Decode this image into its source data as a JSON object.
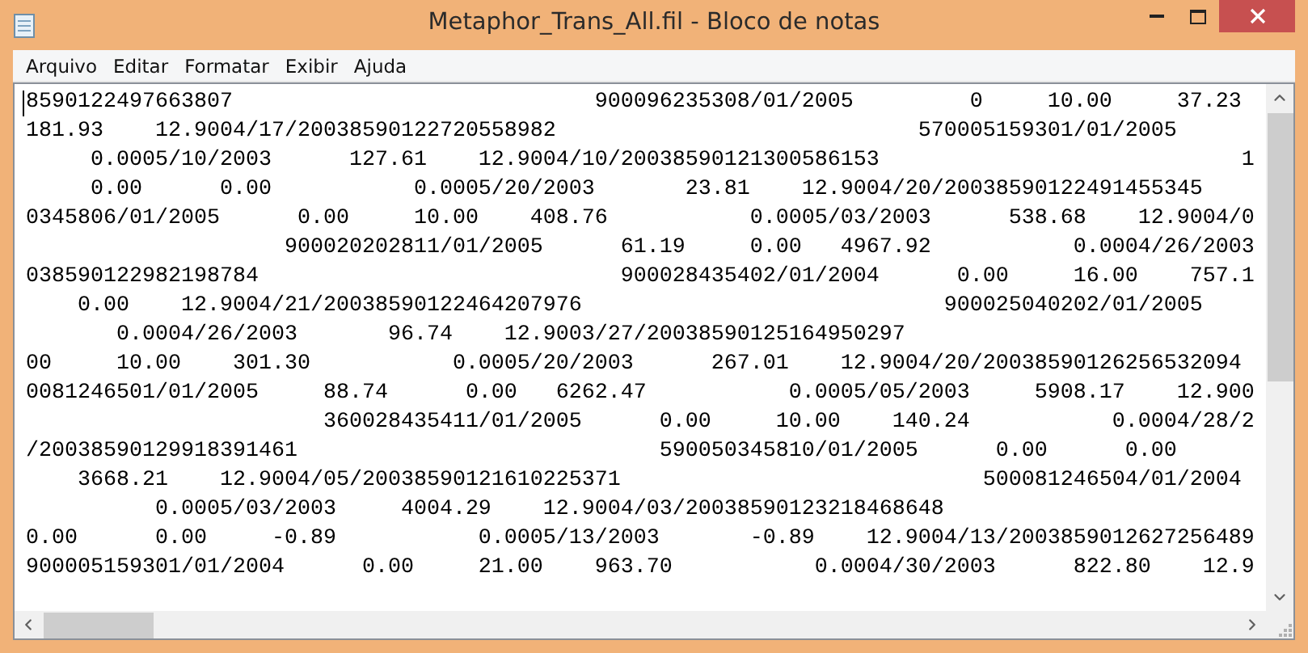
{
  "window": {
    "title": "Metaphor_Trans_All.fil - Bloco de notas"
  },
  "menu": [
    "Arquivo",
    "Editar",
    "Formatar",
    "Exibir",
    "Ajuda"
  ],
  "lines": [
    "8590122497663807                            900096235308/01/2005         0     10.00     37.23",
    "181.93    12.9004/17/20038590122720558982                            570005159301/01/2005",
    "     0.0005/10/2003      127.61    12.9004/10/20038590121300586153                            1",
    "     0.00      0.00           0.0005/20/2003       23.81    12.9004/20/20038590122491455345",
    "0345806/01/2005      0.00     10.00    408.76           0.0005/03/2003      538.68    12.9004/0",
    "                    900020202811/01/2005      61.19     0.00   4967.92           0.0004/26/2003",
    "038590122982198784                            900028435402/01/2004      0.00     16.00    757.1",
    "    0.00    12.9004/21/20038590122464207976                            900025040202/01/2005",
    "       0.0004/26/2003       96.74    12.9003/27/20038590125164950297",
    "00     10.00    301.30           0.0005/20/2003      267.01    12.9004/20/20038590126256532094",
    "0081246501/01/2005     88.74      0.00   6262.47           0.0005/05/2003     5908.17    12.900",
    "                       360028435411/01/2005      0.00     10.00    140.24           0.0004/28/2",
    "/20038590129918391461                            590050345810/01/2005      0.00      0.00",
    "    3668.21    12.9004/05/20038590121610225371                            500081246504/01/2004",
    "          0.0005/03/2003     4004.29    12.9004/03/20038590123218468648",
    "0.00      0.00     -0.89           0.0005/13/2003       -0.89    12.9004/13/2003859012627256489",
    "900005159301/01/2004      0.00     21.00    963.70           0.0004/30/2003      822.80    12.9"
  ]
}
